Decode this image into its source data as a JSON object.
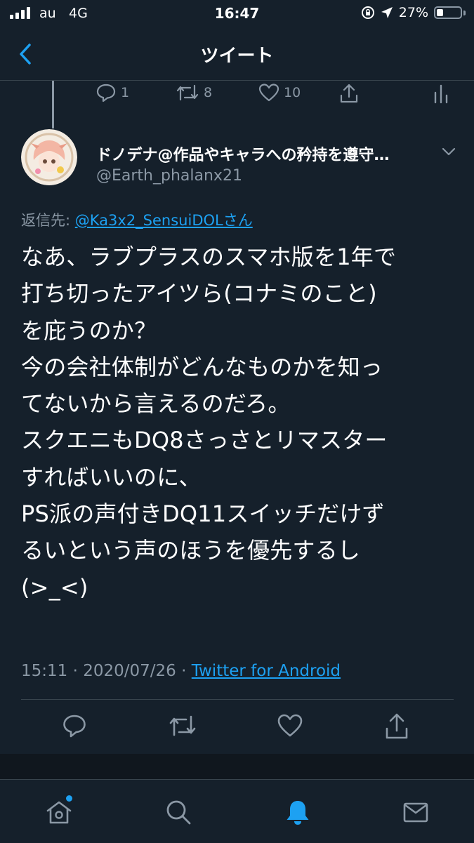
{
  "status_bar": {
    "carrier": "au",
    "network": "4G",
    "time": "16:47",
    "battery": "27%",
    "battery_level": 0.27
  },
  "header": {
    "title": "ツイート"
  },
  "previous_tweet": {
    "reply_count": "1",
    "retweet_count": "8",
    "like_count": "10"
  },
  "tweet": {
    "display_name": "ドノデナ@作品やキャラへの矜持を遵守…",
    "handle": "@Earth_phalanx21",
    "reply_prefix": "返信先: ",
    "reply_mention": "@Ka3x2_SensuiDOLさん",
    "text": "なあ、ラブプラスのスマホ版を1年で\n打ち切ったアイツら(コナミのこと)\nを庇うのか？\n今の会社体制がどんなものかを知っ\nてないから言えるのだろ。\nスクエニもDQ8さっさとリマスター\nすればいいのに、\nPS派の声付きDQ11スイッチだけず\nるいという声のほうを優先するし\n(>_<)",
    "time": "15:11",
    "date": "2020/07/26",
    "separator": " · ",
    "source": "Twitter for Android"
  },
  "colors": {
    "background": "#15202b",
    "accent": "#1da1f2",
    "secondary_text": "#8b98a5",
    "divider": "#38444d"
  },
  "icons": {
    "back": "chevron-left-icon",
    "reply": "reply-icon",
    "retweet": "retweet-icon",
    "like": "heart-icon",
    "share": "share-icon",
    "analytics": "analytics-icon",
    "home": "home-icon",
    "search": "search-icon",
    "notifications": "bell-icon",
    "messages": "mail-icon"
  }
}
